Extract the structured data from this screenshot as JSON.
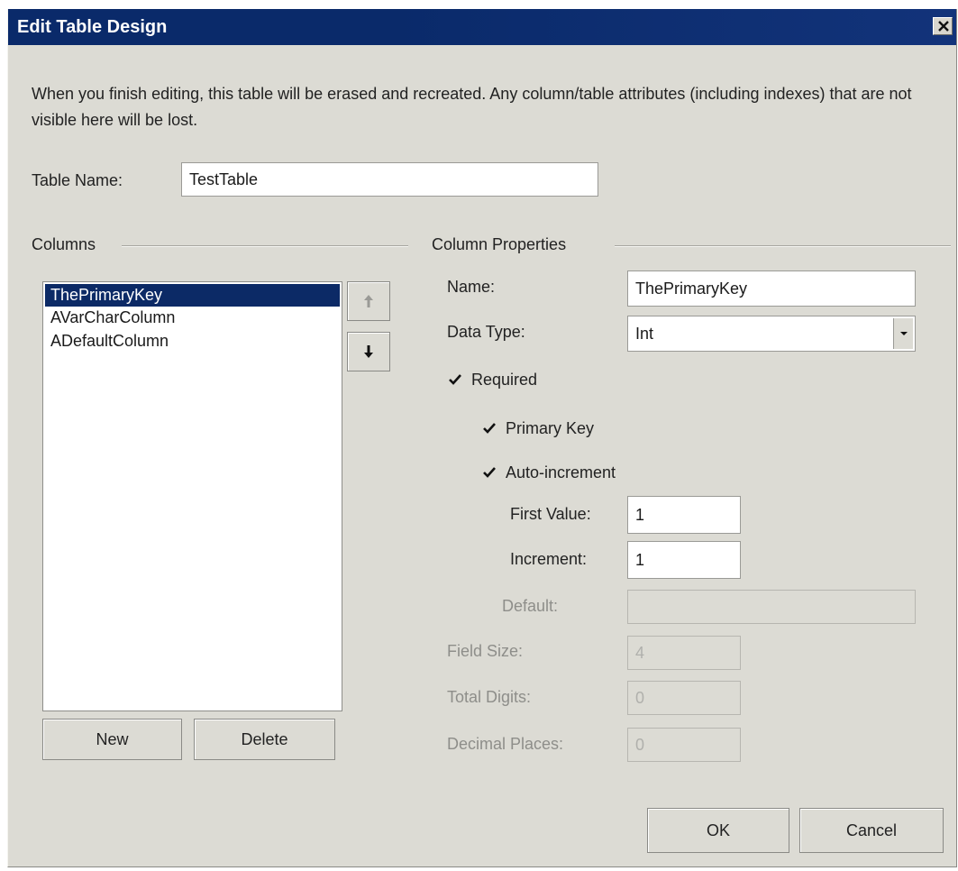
{
  "window": {
    "title": "Edit Table Design"
  },
  "notice": "When you finish editing, this table will be erased and recreated. Any column/table attributes (including indexes) that are not visible here will be lost.",
  "table_name": {
    "label": "Table Name:",
    "value": "TestTable"
  },
  "columns": {
    "group_label": "Columns",
    "items": [
      "ThePrimaryKey",
      "AVarCharColumn",
      "ADefaultColumn"
    ],
    "selected": "ThePrimaryKey",
    "new_label": "New",
    "delete_label": "Delete",
    "move_up_icon": "arrow-up-icon",
    "move_down_icon": "arrow-down-icon"
  },
  "properties": {
    "group_label": "Column Properties",
    "name_label": "Name:",
    "name_value": "ThePrimaryKey",
    "data_type_label": "Data Type:",
    "data_type_value": "Int",
    "required_label": "Required",
    "required_checked": true,
    "primary_key_label": "Primary Key",
    "primary_key_checked": true,
    "auto_increment_label": "Auto-increment",
    "auto_increment_checked": true,
    "first_value_label": "First Value:",
    "first_value": "1",
    "increment_label": "Increment:",
    "increment_value": "1",
    "default_label": "Default:",
    "default_value": "",
    "field_size_label": "Field Size:",
    "field_size_value": "4",
    "total_digits_label": "Total Digits:",
    "total_digits_value": "0",
    "decimal_places_label": "Decimal Places:",
    "decimal_places_value": "0"
  },
  "footer": {
    "ok_label": "OK",
    "cancel_label": "Cancel"
  },
  "colors": {
    "titlebar": "#0a2a6a",
    "dialog_background": "#dcdbd4",
    "selection": "#0c2a66"
  }
}
